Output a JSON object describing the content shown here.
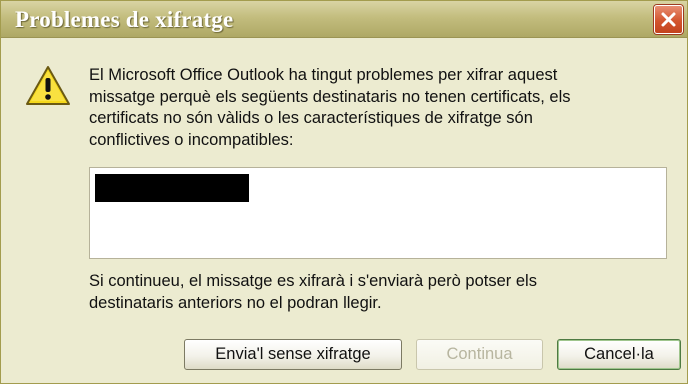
{
  "dialog": {
    "title": "Problemes de xifratge",
    "message": "El Microsoft Office Outlook ha tingut problemes per xifrar aquest\nmissatge perquè els següents destinataris no tenen certificats, els\ncertificats no són vàlids o les característiques de xifratge són\nconflictives o incompatibles:",
    "note": "Si continueu, el missatge es xifrarà i s'enviarà però potser els\ndestinataris anteriors no el podran llegir.",
    "icon": "warning-icon"
  },
  "buttons": {
    "send_without_encryption": "Envia'l sense xifratge",
    "continue": "Continua",
    "cancel": "Cancel·la"
  },
  "colors": {
    "titlebar": "#c3bd7e",
    "window_bg": "#ecebd0",
    "close_button": "#d3552f",
    "warning_yellow": "#f5d81a"
  }
}
